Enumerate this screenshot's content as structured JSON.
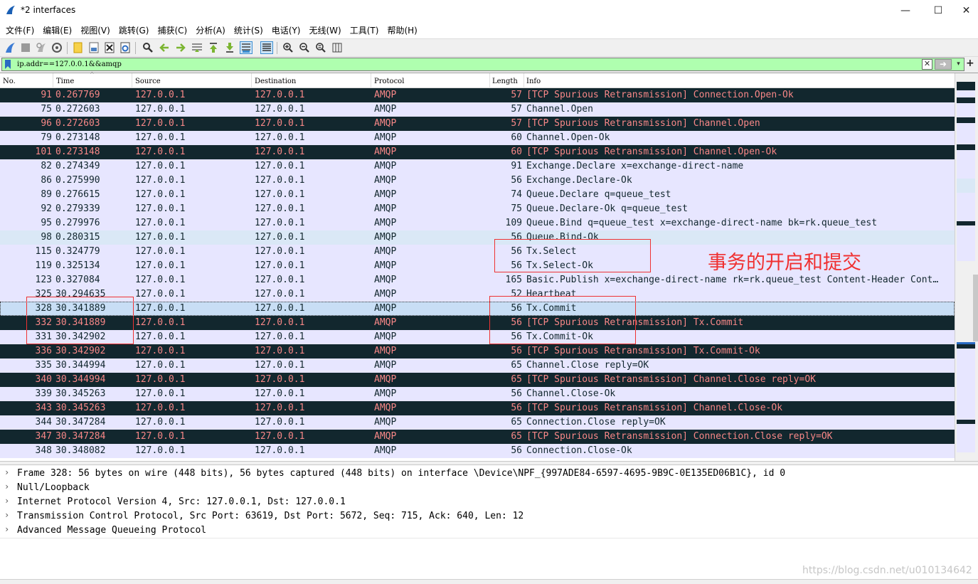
{
  "window": {
    "title": "*2 interfaces",
    "minimize": "—",
    "maximize": "☐",
    "close": "✕"
  },
  "menu": [
    "文件(F)",
    "编辑(E)",
    "视图(V)",
    "跳转(G)",
    "捕获(C)",
    "分析(A)",
    "统计(S)",
    "电话(Y)",
    "无线(W)",
    "工具(T)",
    "帮助(H)"
  ],
  "filter": {
    "value": "ip.addr==127.0.0.1&&amqp",
    "clear": "✕",
    "apply": "➜",
    "dropdown": "▾",
    "add": "+"
  },
  "columns": [
    "No.",
    "Time",
    "Source",
    "Destination",
    "Protocol",
    "Length",
    "Info"
  ],
  "rows": [
    {
      "no": "91",
      "time": "0.267769",
      "src": "127.0.0.1",
      "dst": "127.0.0.1",
      "proto": "AMQP",
      "len": "57",
      "info": "[TCP Spurious Retransmission] Connection.Open-Ok",
      "style": "bad"
    },
    {
      "no": "75",
      "time": "0.272603",
      "src": "127.0.0.1",
      "dst": "127.0.0.1",
      "proto": "AMQP",
      "len": "57",
      "info": "Channel.Open",
      "style": "normal"
    },
    {
      "no": "96",
      "time": "0.272603",
      "src": "127.0.0.1",
      "dst": "127.0.0.1",
      "proto": "AMQP",
      "len": "57",
      "info": "[TCP Spurious Retransmission] Channel.Open",
      "style": "bad"
    },
    {
      "no": "79",
      "time": "0.273148",
      "src": "127.0.0.1",
      "dst": "127.0.0.1",
      "proto": "AMQP",
      "len": "60",
      "info": "Channel.Open-Ok",
      "style": "normal"
    },
    {
      "no": "101",
      "time": "0.273148",
      "src": "127.0.0.1",
      "dst": "127.0.0.1",
      "proto": "AMQP",
      "len": "60",
      "info": "[TCP Spurious Retransmission] Channel.Open-Ok",
      "style": "bad"
    },
    {
      "no": "82",
      "time": "0.274349",
      "src": "127.0.0.1",
      "dst": "127.0.0.1",
      "proto": "AMQP",
      "len": "91",
      "info": "Exchange.Declare x=exchange-direct-name",
      "style": "normal"
    },
    {
      "no": "86",
      "time": "0.275990",
      "src": "127.0.0.1",
      "dst": "127.0.0.1",
      "proto": "AMQP",
      "len": "56",
      "info": "Exchange.Declare-Ok",
      "style": "normal"
    },
    {
      "no": "89",
      "time": "0.276615",
      "src": "127.0.0.1",
      "dst": "127.0.0.1",
      "proto": "AMQP",
      "len": "74",
      "info": "Queue.Declare q=queue_test",
      "style": "normal"
    },
    {
      "no": "92",
      "time": "0.279339",
      "src": "127.0.0.1",
      "dst": "127.0.0.1",
      "proto": "AMQP",
      "len": "75",
      "info": "Queue.Declare-Ok q=queue_test",
      "style": "normal"
    },
    {
      "no": "95",
      "time": "0.279976",
      "src": "127.0.0.1",
      "dst": "127.0.0.1",
      "proto": "AMQP",
      "len": "109",
      "info": "Queue.Bind q=queue_test x=exchange-direct-name bk=rk.queue_test",
      "style": "normal"
    },
    {
      "no": "98",
      "time": "0.280315",
      "src": "127.0.0.1",
      "dst": "127.0.0.1",
      "proto": "AMQP",
      "len": "56",
      "info": "Queue.Bind-Ok",
      "style": "light"
    },
    {
      "no": "115",
      "time": "0.324779",
      "src": "127.0.0.1",
      "dst": "127.0.0.1",
      "proto": "AMQP",
      "len": "56",
      "info": "Tx.Select",
      "style": "normal"
    },
    {
      "no": "119",
      "time": "0.325134",
      "src": "127.0.0.1",
      "dst": "127.0.0.1",
      "proto": "AMQP",
      "len": "56",
      "info": "Tx.Select-Ok",
      "style": "normal"
    },
    {
      "no": "123",
      "time": "0.327084",
      "src": "127.0.0.1",
      "dst": "127.0.0.1",
      "proto": "AMQP",
      "len": "165",
      "info": "Basic.Publish x=exchange-direct-name rk=rk.queue_test Content-Header Cont…",
      "style": "normal"
    },
    {
      "no": "325",
      "time": "30.294635",
      "src": "127.0.0.1",
      "dst": "127.0.0.1",
      "proto": "AMQP",
      "len": "52",
      "info": "Heartbeat",
      "style": "normal"
    },
    {
      "no": "328",
      "time": "30.341889",
      "src": "127.0.0.1",
      "dst": "127.0.0.1",
      "proto": "AMQP",
      "len": "56",
      "info": "Tx.Commit",
      "style": "selected"
    },
    {
      "no": "332",
      "time": "30.341889",
      "src": "127.0.0.1",
      "dst": "127.0.0.1",
      "proto": "AMQP",
      "len": "56",
      "info": "[TCP Spurious Retransmission] Tx.Commit",
      "style": "bad"
    },
    {
      "no": "331",
      "time": "30.342902",
      "src": "127.0.0.1",
      "dst": "127.0.0.1",
      "proto": "AMQP",
      "len": "56",
      "info": "Tx.Commit-Ok",
      "style": "normal"
    },
    {
      "no": "336",
      "time": "30.342902",
      "src": "127.0.0.1",
      "dst": "127.0.0.1",
      "proto": "AMQP",
      "len": "56",
      "info": "[TCP Spurious Retransmission] Tx.Commit-Ok",
      "style": "bad"
    },
    {
      "no": "335",
      "time": "30.344994",
      "src": "127.0.0.1",
      "dst": "127.0.0.1",
      "proto": "AMQP",
      "len": "65",
      "info": "Channel.Close reply=OK",
      "style": "normal"
    },
    {
      "no": "340",
      "time": "30.344994",
      "src": "127.0.0.1",
      "dst": "127.0.0.1",
      "proto": "AMQP",
      "len": "65",
      "info": "[TCP Spurious Retransmission] Channel.Close reply=OK",
      "style": "bad"
    },
    {
      "no": "339",
      "time": "30.345263",
      "src": "127.0.0.1",
      "dst": "127.0.0.1",
      "proto": "AMQP",
      "len": "56",
      "info": "Channel.Close-Ok",
      "style": "normal"
    },
    {
      "no": "343",
      "time": "30.345263",
      "src": "127.0.0.1",
      "dst": "127.0.0.1",
      "proto": "AMQP",
      "len": "56",
      "info": "[TCP Spurious Retransmission] Channel.Close-Ok",
      "style": "bad"
    },
    {
      "no": "344",
      "time": "30.347284",
      "src": "127.0.0.1",
      "dst": "127.0.0.1",
      "proto": "AMQP",
      "len": "65",
      "info": "Connection.Close reply=OK",
      "style": "normal"
    },
    {
      "no": "347",
      "time": "30.347284",
      "src": "127.0.0.1",
      "dst": "127.0.0.1",
      "proto": "AMQP",
      "len": "65",
      "info": "[TCP Spurious Retransmission] Connection.Close reply=OK",
      "style": "bad"
    },
    {
      "no": "348",
      "time": "30.348082",
      "src": "127.0.0.1",
      "dst": "127.0.0.1",
      "proto": "AMQP",
      "len": "56",
      "info": "Connection.Close-Ok",
      "style": "normal"
    }
  ],
  "annotation": "事务的开启和提交",
  "details": [
    "Frame 328: 56 bytes on wire (448 bits), 56 bytes captured (448 bits) on interface \\Device\\NPF_{997ADE84-6597-4695-9B9C-0E135ED06B1C}, id 0",
    "Null/Loopback",
    "Internet Protocol Version 4, Src: 127.0.0.1, Dst: 127.0.0.1",
    "Transmission Control Protocol, Src Port: 63619, Dst Port: 5672, Seq: 715, Ack: 640, Len: 12",
    "Advanced Message Queueing Protocol"
  ],
  "watermark": "https://blog.csdn.net/u010134642",
  "colors": {
    "normal_bg": "#e7e6ff",
    "bad_bg": "#12272e",
    "bad_fg": "#f78787",
    "filter_bg": "#afffaf",
    "annotation": "#f03030"
  },
  "icons": {
    "app": "wireshark-fin-icon",
    "bookmark": "bookmark-icon"
  }
}
